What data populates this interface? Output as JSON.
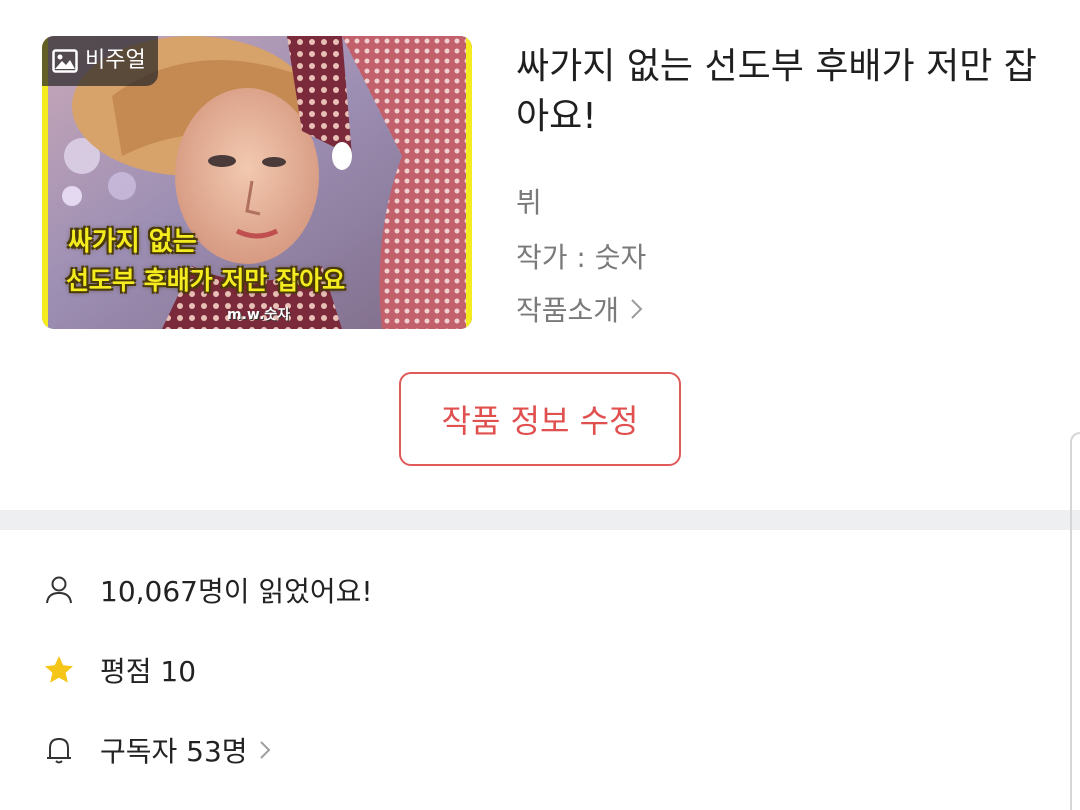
{
  "work": {
    "badge_label": "비주얼",
    "cover_text_line1": "싸가지 없는",
    "cover_text_line2": "선도부 후배가 저만 잡아요",
    "cover_credit": "m.w.숫자",
    "title": "싸가지 없는 선도부 후배가 저만 잡아요!",
    "genre": "뷔",
    "author": "작가 : 숫자",
    "intro_label": "작품소개"
  },
  "actions": {
    "edit_label": "작품 정보 수정"
  },
  "stats": {
    "reads": "10,067명이 읽었어요!",
    "rating": "평점 10",
    "subscribers": "구독자 53명"
  },
  "colors": {
    "accent": "#e0504f",
    "star": "#f5c518",
    "divider": "#eeeff1"
  },
  "icons": {
    "badge": "image-icon",
    "reads": "person-icon",
    "rating": "star-icon",
    "subscribers": "bell-icon",
    "chevron": "chevron-right-icon"
  }
}
